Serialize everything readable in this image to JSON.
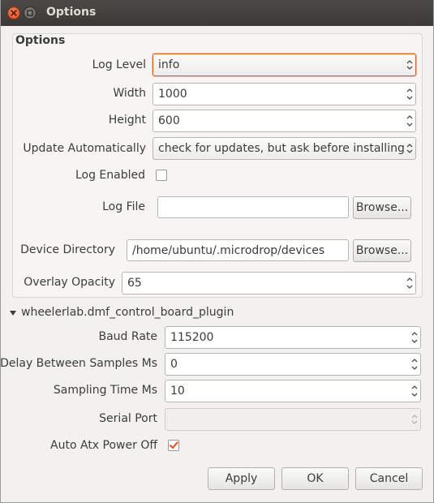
{
  "window": {
    "title": "Options"
  },
  "options": {
    "group_title": "Options",
    "log_level": {
      "label": "Log Level",
      "value": "info"
    },
    "width": {
      "label": "Width",
      "value": "1000"
    },
    "height": {
      "label": "Height",
      "value": "600"
    },
    "update_automatically": {
      "label": "Update Automatically",
      "value": "check for updates, but ask before installing"
    },
    "log_enabled": {
      "label": "Log Enabled",
      "checked": false
    },
    "log_file": {
      "label": "Log File",
      "value": "",
      "browse_label": "Browse..."
    },
    "device_directory": {
      "label": "Device Directory",
      "value": "/home/ubuntu/.microdrop/devices",
      "browse_label": "Browse..."
    },
    "overlay_opacity": {
      "label": "Overlay Opacity",
      "value": "65"
    }
  },
  "plugin": {
    "title": "wheelerlab.dmf_control_board_plugin",
    "expanded": true,
    "baud_rate": {
      "label": "Baud Rate",
      "value": "115200"
    },
    "delay_between_samples": {
      "label": "Delay Between Samples Ms",
      "value": "0"
    },
    "sampling_time": {
      "label": "Sampling Time Ms",
      "value": "10"
    },
    "serial_port": {
      "label": "Serial Port",
      "value": ""
    },
    "auto_atx_power_off": {
      "label": "Auto Atx Power Off",
      "checked": true
    }
  },
  "buttons": {
    "apply": "Apply",
    "ok": "OK",
    "cancel": "Cancel"
  },
  "colors": {
    "accent": "#e05c28",
    "titlebar": "#3c3b37",
    "check_mark": "#e05c28"
  }
}
